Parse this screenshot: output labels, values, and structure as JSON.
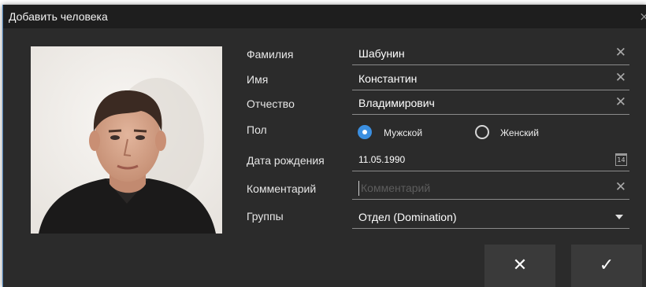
{
  "dialog": {
    "title": "Добавить человека",
    "close_glyph": "×"
  },
  "photo": {
    "subject": "portrait-photo"
  },
  "form": {
    "surname": {
      "label": "Фамилия",
      "value": "Шабунин",
      "clear_glyph": "✕"
    },
    "name": {
      "label": "Имя",
      "value": "Константин",
      "clear_glyph": "✕"
    },
    "patronymic": {
      "label": "Отчество",
      "value": "Владимирович",
      "clear_glyph": "✕"
    },
    "gender": {
      "label": "Пол",
      "options": [
        {
          "label": "Мужской",
          "selected": true
        },
        {
          "label": "Женский",
          "selected": false
        }
      ]
    },
    "birthdate": {
      "label": "Дата рождения",
      "value": "11.05.1990",
      "calendar_day": "14"
    },
    "comment": {
      "label": "Комментарий",
      "placeholder": "Комментарий",
      "clear_glyph": "✕"
    },
    "groups": {
      "label": "Группы",
      "value": "Отдел (Domination)"
    }
  },
  "buttons": {
    "cancel_glyph": "✕",
    "ok_glyph": "✓"
  },
  "colors": {
    "background": "#2b2b2b",
    "titlebar": "#1e1e1e",
    "accent": "#3b8fe0",
    "button": "#3a3a3a"
  }
}
